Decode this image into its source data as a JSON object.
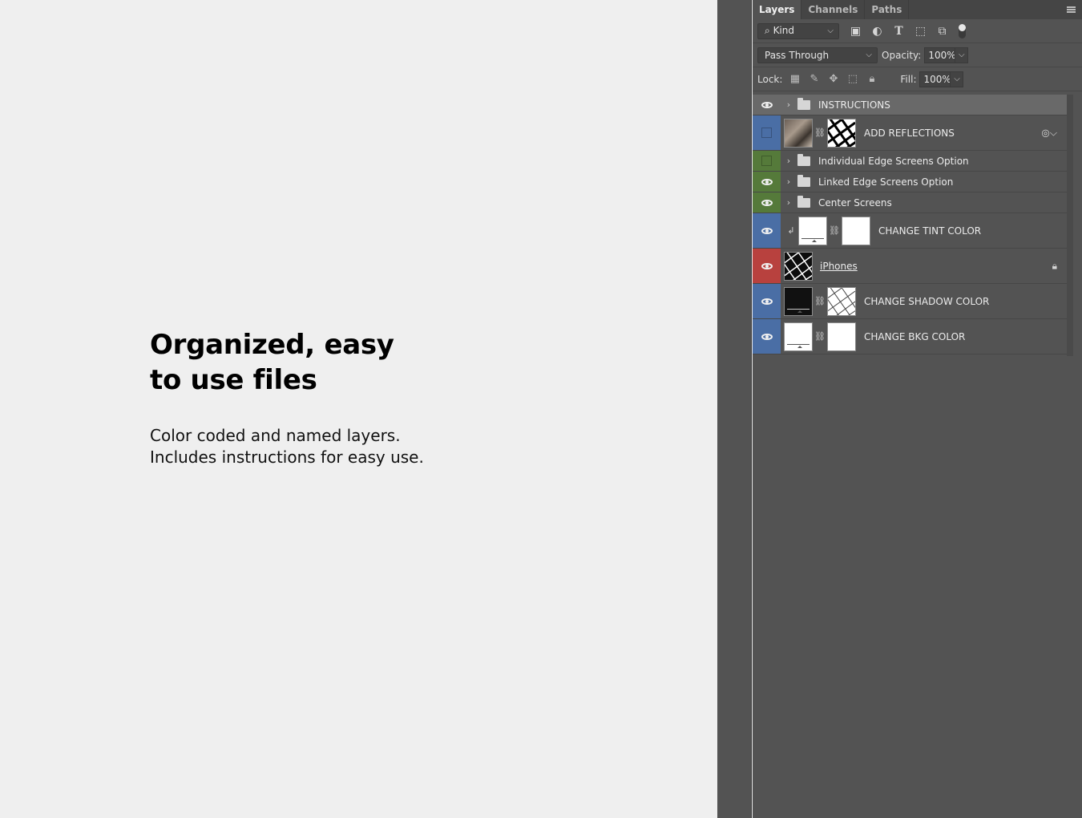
{
  "promo": {
    "heading": "Organized, easy\nto use files",
    "body": "Color coded and named layers.\nIncludes instructions for easy use."
  },
  "panel": {
    "tabs": [
      {
        "label": "Layers",
        "active": true
      },
      {
        "label": "Channels",
        "active": false
      },
      {
        "label": "Paths",
        "active": false
      }
    ],
    "filter": {
      "kind_label": "Kind",
      "icons": [
        "image-filter-icon",
        "adjustment-filter-icon",
        "type-filter-icon",
        "shape-filter-icon",
        "smart-object-filter-icon"
      ]
    },
    "blend": {
      "mode": "Pass Through",
      "opacity_label": "Opacity:",
      "opacity_value": "100%"
    },
    "lock": {
      "label": "Lock:",
      "fill_label": "Fill:",
      "fill_value": "100%"
    }
  },
  "layers": [
    {
      "name": "INSTRUCTIONS",
      "type": "group",
      "visible": true,
      "color": null,
      "selected": true
    },
    {
      "name": "ADD REFLECTIONS",
      "type": "smart-masked",
      "visible": false,
      "color": "#4a6ea5",
      "selected": false
    },
    {
      "name": "Individual Edge Screens Option",
      "type": "group",
      "visible": false,
      "color": "#557a3a",
      "selected": false
    },
    {
      "name": "Linked Edge Screens Option",
      "type": "group",
      "visible": true,
      "color": "#557a3a",
      "selected": false
    },
    {
      "name": "Center Screens",
      "type": "group",
      "visible": true,
      "color": "#557a3a",
      "selected": false
    },
    {
      "name": "CHANGE TINT COLOR",
      "type": "fill-clipped",
      "visible": true,
      "color": "#4a6ea5",
      "selected": false
    },
    {
      "name": "iPhones",
      "type": "locked",
      "visible": true,
      "color": "#b8413e",
      "selected": false
    },
    {
      "name": "CHANGE SHADOW COLOR",
      "type": "fill-dark",
      "visible": true,
      "color": "#4a6ea5",
      "selected": false
    },
    {
      "name": "CHANGE BKG COLOR",
      "type": "fill",
      "visible": true,
      "color": "#4a6ea5",
      "selected": false
    }
  ]
}
